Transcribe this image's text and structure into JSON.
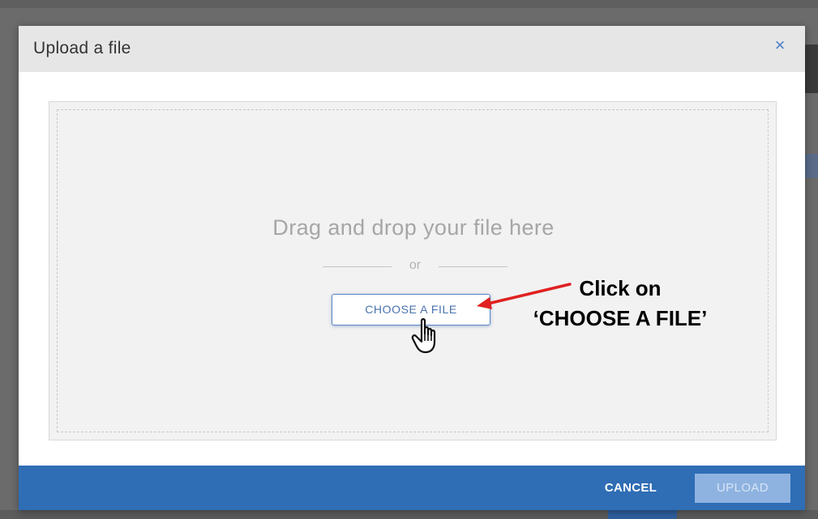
{
  "modal": {
    "title": "Upload a file",
    "close_icon": "close-icon",
    "close_glyph": "×"
  },
  "dropzone": {
    "prompt": "Drag and drop your file here",
    "or_text": "or",
    "choose_button_label": "CHOOSE A FILE"
  },
  "annotation": {
    "line1": "Click on",
    "line2": "‘CHOOSE A FILE’",
    "arrow_color": "#e02020"
  },
  "footer": {
    "cancel_label": "CANCEL",
    "upload_label": "UPLOAD"
  },
  "colors": {
    "accent": "#2f6db5",
    "upload_disabled": "#8fb3e0",
    "header_bg": "#e6e6e6",
    "dropzone_bg": "#f2f2f2"
  }
}
